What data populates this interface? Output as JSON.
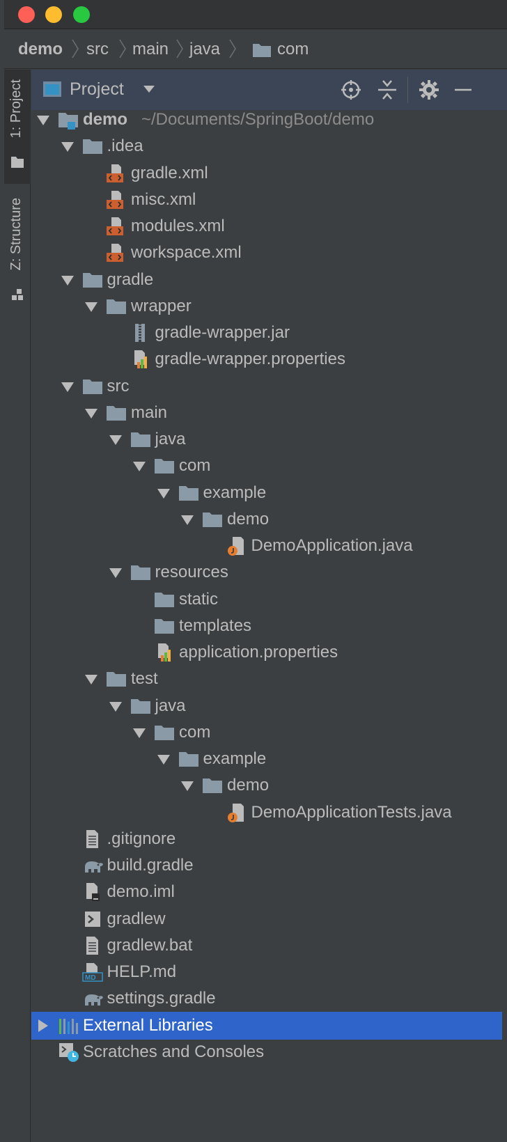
{
  "breadcrumbs": [
    "demo",
    "src",
    "main",
    "java",
    "com"
  ],
  "stripe": {
    "project_tab": "1: Project",
    "structure_tab": "Z: Structure"
  },
  "tool_window": {
    "title": "Project"
  },
  "tree": [
    {
      "label": "demo",
      "hint": "~/Documents/SpringBoot/demo",
      "depth": 0,
      "expanded": true,
      "icon": "module-folder-icon",
      "bold": true
    },
    {
      "label": ".idea",
      "depth": 1,
      "expanded": true,
      "icon": "folder-icon"
    },
    {
      "label": "gradle.xml",
      "depth": 2,
      "icon": "xml-file-icon"
    },
    {
      "label": "misc.xml",
      "depth": 2,
      "icon": "xml-file-icon"
    },
    {
      "label": "modules.xml",
      "depth": 2,
      "icon": "xml-file-icon"
    },
    {
      "label": "workspace.xml",
      "depth": 2,
      "icon": "xml-file-icon"
    },
    {
      "label": "gradle",
      "depth": 1,
      "expanded": true,
      "icon": "folder-icon"
    },
    {
      "label": "wrapper",
      "depth": 2,
      "expanded": true,
      "icon": "folder-icon"
    },
    {
      "label": "gradle-wrapper.jar",
      "depth": 3,
      "icon": "jar-file-icon"
    },
    {
      "label": "gradle-wrapper.properties",
      "depth": 3,
      "icon": "properties-file-icon"
    },
    {
      "label": "src",
      "depth": 1,
      "expanded": true,
      "icon": "folder-icon"
    },
    {
      "label": "main",
      "depth": 2,
      "expanded": true,
      "icon": "folder-icon"
    },
    {
      "label": "java",
      "depth": 3,
      "expanded": true,
      "icon": "folder-icon"
    },
    {
      "label": "com",
      "depth": 4,
      "expanded": true,
      "icon": "folder-icon"
    },
    {
      "label": "example",
      "depth": 5,
      "expanded": true,
      "icon": "folder-icon"
    },
    {
      "label": "demo",
      "depth": 6,
      "expanded": true,
      "icon": "folder-icon"
    },
    {
      "label": "DemoApplication.java",
      "depth": 7,
      "icon": "java-file-icon"
    },
    {
      "label": "resources",
      "depth": 3,
      "expanded": true,
      "icon": "folder-icon"
    },
    {
      "label": "static",
      "depth": 4,
      "icon": "folder-icon"
    },
    {
      "label": "templates",
      "depth": 4,
      "icon": "folder-icon"
    },
    {
      "label": "application.properties",
      "depth": 4,
      "icon": "properties-file-icon"
    },
    {
      "label": "test",
      "depth": 2,
      "expanded": true,
      "icon": "folder-icon"
    },
    {
      "label": "java",
      "depth": 3,
      "expanded": true,
      "icon": "folder-icon"
    },
    {
      "label": "com",
      "depth": 4,
      "expanded": true,
      "icon": "folder-icon"
    },
    {
      "label": "example",
      "depth": 5,
      "expanded": true,
      "icon": "folder-icon"
    },
    {
      "label": "demo",
      "depth": 6,
      "expanded": true,
      "icon": "folder-icon"
    },
    {
      "label": "DemoApplicationTests.java",
      "depth": 7,
      "icon": "java-file-icon"
    },
    {
      "label": ".gitignore",
      "depth": 1,
      "icon": "text-file-icon"
    },
    {
      "label": "build.gradle",
      "depth": 1,
      "icon": "gradle-elephant-icon"
    },
    {
      "label": "demo.iml",
      "depth": 1,
      "icon": "iml-file-icon"
    },
    {
      "label": "gradlew",
      "depth": 1,
      "icon": "shell-script-icon"
    },
    {
      "label": "gradlew.bat",
      "depth": 1,
      "icon": "text-file-icon"
    },
    {
      "label": "HELP.md",
      "depth": 1,
      "icon": "markdown-file-icon"
    },
    {
      "label": "settings.gradle",
      "depth": 1,
      "icon": "gradle-elephant-icon"
    },
    {
      "label": "External Libraries",
      "depth": 0,
      "expanded": false,
      "icon": "libraries-icon",
      "selected": true
    },
    {
      "label": "Scratches and Consoles",
      "depth": 0,
      "icon": "scratches-icon"
    }
  ],
  "colors": {
    "selection": "#2f65ca",
    "folder": "#8b9aa7",
    "xml": "#cc5f30",
    "java": "#e77e2f",
    "module_badge": "#3592c4"
  }
}
